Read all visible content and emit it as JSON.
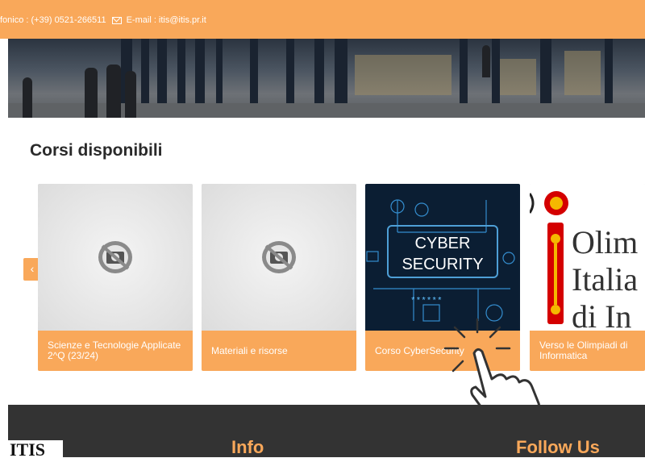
{
  "topbar": {
    "phone_text": "fonico : (+39) 0521-266511",
    "email_text": "E-mail : itis@itis.pr.it"
  },
  "section": {
    "title": "Corsi disponibili"
  },
  "carousel": {
    "prev_label": "‹",
    "cards": [
      {
        "caption": "Scienze e Tecnologie Applicate 2^Q (23/24)"
      },
      {
        "caption": "Materiali e risorse"
      },
      {
        "caption": "Corso CyberSecurity"
      },
      {
        "caption": "Verso le Olimpiadi di Informatica"
      }
    ],
    "cyber_image_text": [
      "CYBER",
      "SECURITY",
      "******"
    ],
    "olimp_image_text": [
      "Olim",
      "Italia",
      "di In"
    ]
  },
  "footer": {
    "logo_text": "ITIS",
    "info_heading": "Info",
    "follow_heading": "Follow Us"
  },
  "colors": {
    "accent": "#f9a85a",
    "footer_bg": "#333333",
    "cyber_bg": "#0b1e33"
  }
}
